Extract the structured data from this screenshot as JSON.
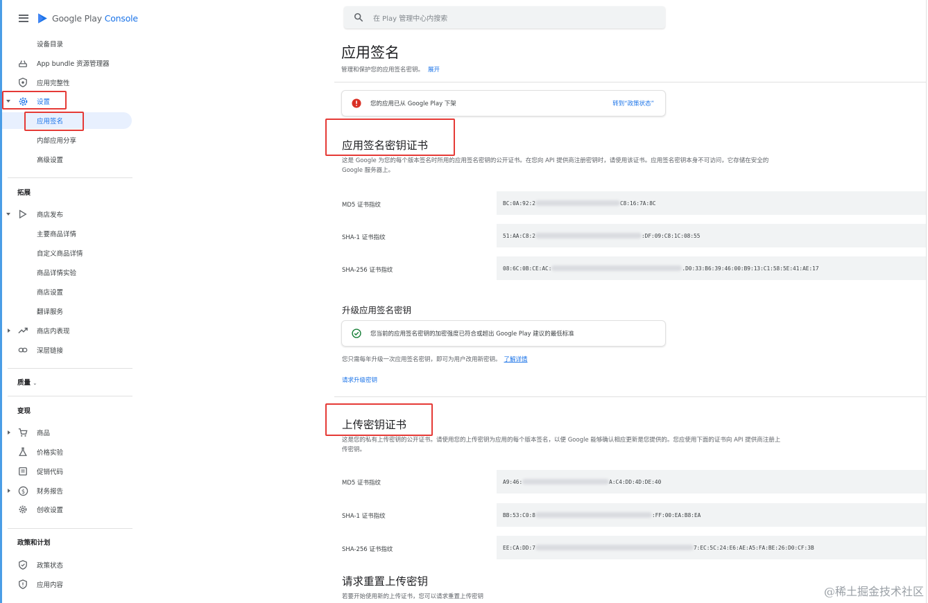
{
  "app": {
    "logo_google_play": "Google Play ",
    "logo_console": "Console"
  },
  "search": {
    "placeholder": "在 Play 管理中心内搜索"
  },
  "sidebar": {
    "items": [
      {
        "label": "设备目录",
        "icon": ""
      },
      {
        "label": "App bundle 资源管理器",
        "icon": "bundle-icon"
      },
      {
        "label": "应用完整性",
        "icon": "shield-icon"
      },
      {
        "label": "设置",
        "icon": "gear-icon"
      },
      {
        "label": "应用签名",
        "icon": ""
      },
      {
        "label": "内部应用分享",
        "icon": ""
      },
      {
        "label": "高级设置",
        "icon": ""
      }
    ],
    "section_expand": "拓展",
    "expand_items": [
      {
        "label": "商店发布",
        "icon": "play-icon"
      },
      {
        "label": "主要商品详情",
        "icon": ""
      },
      {
        "label": "自定义商品详情",
        "icon": ""
      },
      {
        "label": "商品详情实验",
        "icon": ""
      },
      {
        "label": "商店设置",
        "icon": ""
      },
      {
        "label": "翻译服务",
        "icon": ""
      },
      {
        "label": "商店内表现",
        "icon": "trending-icon"
      },
      {
        "label": "深层链接",
        "icon": "link-icon"
      }
    ],
    "section_quality": "质量",
    "section_monetize": "变现",
    "monetize_items": [
      {
        "label": "商品",
        "icon": "cart-icon"
      },
      {
        "label": "价格实验",
        "icon": "flask-icon"
      },
      {
        "label": "促销代码",
        "icon": "promo-icon"
      },
      {
        "label": "财务报告",
        "icon": "dollar-icon"
      },
      {
        "label": "创收设置",
        "icon": "gear-icon"
      }
    ],
    "section_policy": "政策和计划",
    "policy_items": [
      {
        "label": "政策状态",
        "icon": "shield-check-icon"
      },
      {
        "label": "应用内容",
        "icon": "shield-info-icon"
      }
    ]
  },
  "main": {
    "title": "应用签名",
    "subtitle": "管理和保护您的应用签名密钥。",
    "subtitle_link": "展开",
    "alert": {
      "text": "您的应用已从 Google Play 下架",
      "link": "转到“政策状态”"
    },
    "app_signing": {
      "heading": "应用签名密钥证书",
      "desc": "这是 Google 为您的每个版本签名时所用的应用签名密钥的公开证书。在您向 API 提供商注册密钥时，请使用该证书。应用签名密钥本身不可访问，它存储在安全的 Google 服务器上。",
      "fingerprints": [
        {
          "label": "MD5 证书指纹",
          "prefix": "BC:0A:92:2",
          "suffix": "C8:16:7A:8C"
        },
        {
          "label": "SHA-1 证书指纹",
          "prefix": "51:AA:C8:2",
          "suffix": ":DF:09:C8:1C:08:55"
        },
        {
          "label": "SHA-256 证书指纹",
          "prefix": "08:6C:0B:CE:AC:",
          "suffix": ".D0:33:B6:39:46:00:B9:13:C1:58:5E:41:AE:17"
        }
      ]
    },
    "upgrade": {
      "heading": "升级应用签名密钥",
      "status": "您当前的应用签名密钥的加密强度已符合或超出 Google Play 建议的最低标准",
      "note": "您只需每年升级一次应用签名密钥，即可为用户改用新密钥。",
      "note_link": "了解详情",
      "request_link": "请求升级密钥"
    },
    "upload": {
      "heading": "上传密钥证书",
      "desc": "这是您的私有上传密钥的公开证书。请使用您的上传密钥为应用的每个版本签名，以便 Google 能够确认相应更新是您提供的。您应使用下面的证书向 API 提供商注册上传密钥。",
      "fingerprints": [
        {
          "label": "MD5 证书指纹",
          "prefix": "A9:46:",
          "suffix": "A:C4:DD:4D:DE:40"
        },
        {
          "label": "SHA-1 证书指纹",
          "prefix": "BB:53:C0:8",
          "suffix": ":FF:00:EA:B8:EA"
        },
        {
          "label": "SHA-256 证书指纹",
          "prefix": "EE:CA:DD:7",
          "suffix": "7:EC:5C:24:E6:AE:A5:FA:BE:26:D0:CF:3B"
        }
      ]
    },
    "reset": {
      "heading": "请求重置上传密钥",
      "desc": "若要开始使用新的上传证书，您可以请求重置上传密钥"
    }
  },
  "watermark": "@稀土掘金技术社区",
  "colors": {
    "accent": "#1a73e8",
    "highlight": "#e53935",
    "error": "#d93025",
    "success": "#188038"
  }
}
